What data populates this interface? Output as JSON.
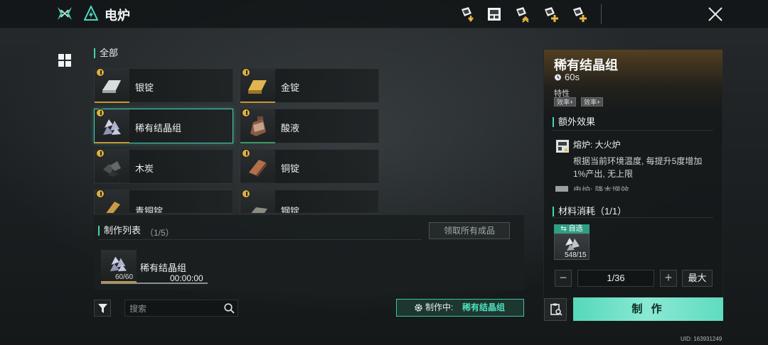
{
  "header": {
    "title": "电炉",
    "toolbar_icons": [
      "collect-down-icon",
      "furnace-swap-icon",
      "upgrade-icon",
      "add-rank-icon",
      "add-rank-alt-icon"
    ],
    "close_icon": "close-icon"
  },
  "category": {
    "label": "全部",
    "tab_icon": "grid-icon"
  },
  "recipes": [
    {
      "name": "银锭",
      "icon": "silver-ingot-icon",
      "badge": "alert-icon",
      "selected": false
    },
    {
      "name": "金锭",
      "icon": "gold-ingot-icon",
      "badge": "alert-icon",
      "selected": false
    },
    {
      "name": "稀有结晶组",
      "icon": "crystal-cluster-icon",
      "badge": "alert-icon",
      "selected": true
    },
    {
      "name": "酸液",
      "icon": "acid-bottle-icon",
      "badge": "alert-icon",
      "selected": false
    },
    {
      "name": "木炭",
      "icon": "charcoal-icon",
      "badge": "alert-icon",
      "selected": false
    },
    {
      "name": "铜锭",
      "icon": "copper-ingot-icon",
      "badge": "alert-icon",
      "selected": false
    },
    {
      "name": "青铜锭",
      "icon": "bronze-ingot-icon",
      "badge": "alert-icon",
      "selected": false
    },
    {
      "name": "钢锭",
      "icon": "steel-ingot-icon",
      "badge": "alert-icon",
      "selected": false
    }
  ],
  "queue": {
    "title": "制作列表",
    "count": "（1/5）",
    "claim_all_label": "领取所有成品",
    "items": [
      {
        "name": "稀有结晶组",
        "qty": "60/60",
        "timer": "00:00:00",
        "progress": 1.0
      }
    ]
  },
  "search": {
    "placeholder": "搜索",
    "value": ""
  },
  "crafting_status": {
    "label": "制作中:",
    "item": "稀有结晶组"
  },
  "detail": {
    "title": "稀有结晶组",
    "time": "60s",
    "traits_label": "特性",
    "traits": [
      "效率+",
      "效率+"
    ],
    "extra_effects_title": "额外效果",
    "effect_name": "熔炉: 大火炉",
    "effect_desc": "根据当前环境温度, 每提升5度增加1%产出, 无上限",
    "effect_more": "电炉: 降本增效",
    "materials_title": "材料消耗（1/1）",
    "auto_select_label": "自选",
    "material_count": "548/15",
    "quantity": "1/36",
    "minus_label": "−",
    "plus_label": "+",
    "max_label": "最大",
    "craft_label": "制 作"
  },
  "footer": {
    "uid": "UID: 163931249"
  },
  "colors": {
    "accent": "#45d2b4",
    "craft_button": "#6fe2c6",
    "gold": "#c8963a",
    "badge": "#d8b24a"
  }
}
